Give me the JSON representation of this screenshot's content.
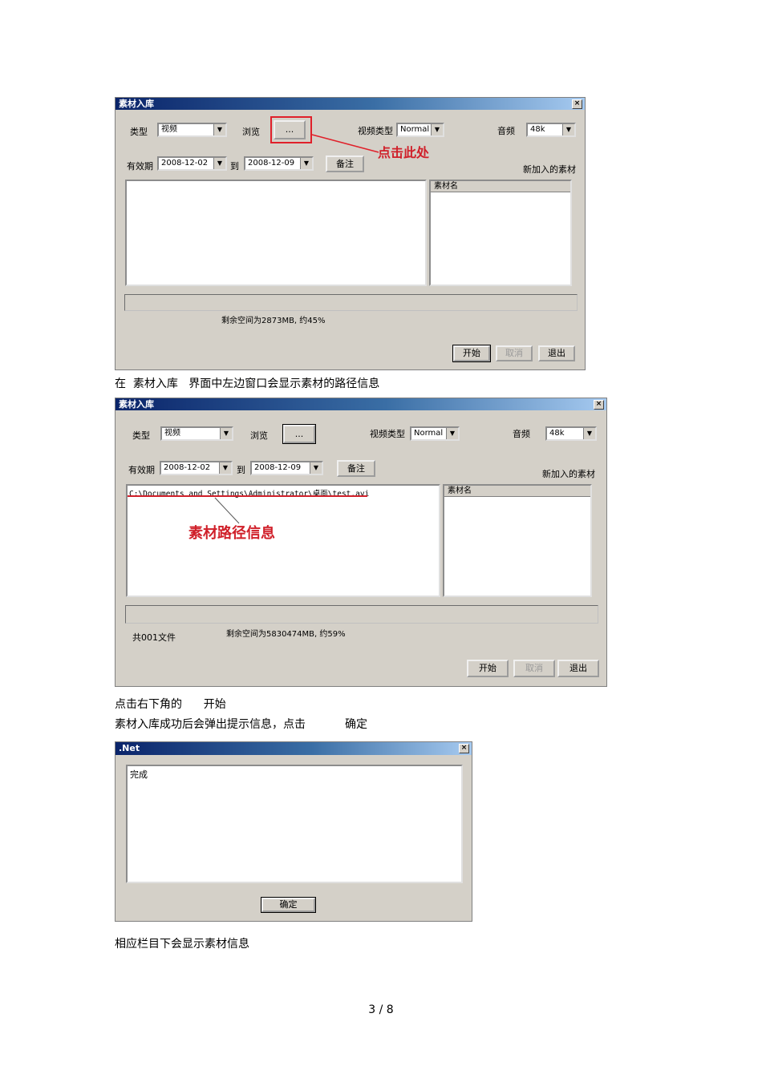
{
  "dialog1": {
    "title": "素材入库",
    "close": "×",
    "type_label": "类型",
    "type_value": "视频",
    "browse_label": "浏览",
    "browse_button": "...",
    "video_type_label": "视频类型",
    "video_type_value": "Normal",
    "audio_label": "音频",
    "audio_value": "48k",
    "validity_label": "有效期",
    "date_from": "2008-12-02",
    "to_label": "到",
    "date_to": "2008-12-09",
    "remark_button": "备注",
    "new_material_label": "新加入的素材",
    "list_header": "素材名",
    "space_text": "剩余空间为2873MB, 约45%",
    "start_button": "开始",
    "cancel_button": "取消",
    "exit_button": "退出",
    "annotation": "点击此处"
  },
  "caption1": "在  素材入库   界面中左边窗口会显示素材的路径信息",
  "dialog2": {
    "title": "素材入库",
    "close": "×",
    "type_label": "类型",
    "type_value": "视频",
    "browse_label": "浏览",
    "browse_button": "...",
    "video_type_label": "视频类型",
    "video_type_value": "Normal",
    "audio_label": "音频",
    "audio_value": "48k",
    "validity_label": "有效期",
    "date_from": "2008-12-02",
    "to_label": "到",
    "date_to": "2008-12-09",
    "remark_button": "备注",
    "new_material_label": "新加入的素材",
    "path": "C:\\Documents and Settings\\Administrator\\桌面\\test.avi",
    "list_header": "素材名",
    "file_count": "共001文件",
    "space_text": "剩余空间为5830474MB, 约59%",
    "start_button": "开始",
    "cancel_button": "取消",
    "exit_button": "退出",
    "annotation": "素材路径信息"
  },
  "caption2": "点击右下角的      开始",
  "caption3": "素材入库成功后会弹出提示信息，点击           确定",
  "dialog3": {
    "title": ".Net",
    "close": "×",
    "message": "完成",
    "ok_button": "确定"
  },
  "caption4": "相应栏目下会显示素材信息",
  "page_number": "3 / 8"
}
